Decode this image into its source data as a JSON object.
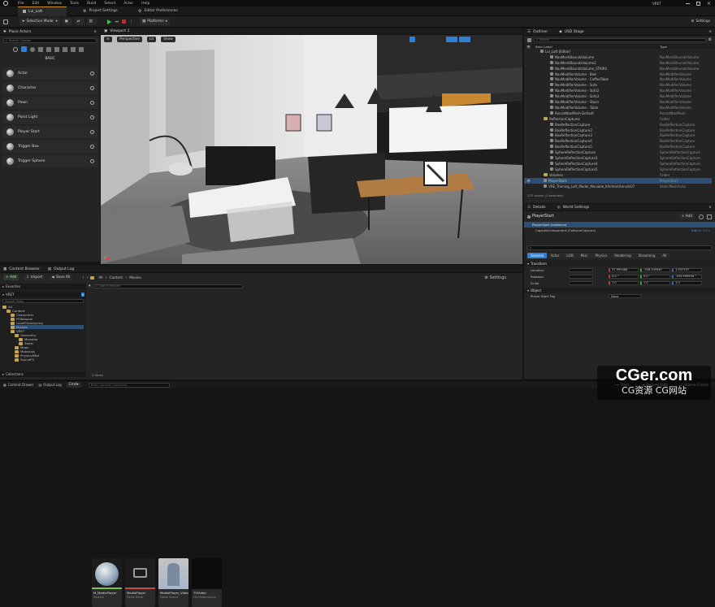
{
  "menu": [
    "File",
    "Edit",
    "Window",
    "Tools",
    "Build",
    "Select",
    "Actor",
    "Help"
  ],
  "window": {
    "level_tab": "Lvl_Loft",
    "project_settings": "Project Settings",
    "editor_prefs": "Editor Preferences",
    "user_badge": "VRET"
  },
  "toolbar": {
    "selection_mode": "Selection Mode",
    "platforms": "Platforms",
    "settings": "Settings"
  },
  "place_actors": {
    "tab": "Place Actors",
    "search_placeholder": "Search Classes",
    "category": "BASIC",
    "items": [
      "Actor",
      "Character",
      "Pawn",
      "Point Light",
      "Player Start",
      "Trigger Box",
      "Trigger Sphere"
    ]
  },
  "viewport": {
    "tab": "Viewport 1",
    "perspective": "Perspective",
    "lit": "Lit",
    "show": "Show"
  },
  "outliner": {
    "tab1": "Outliner",
    "tab2": "USD Stage",
    "search_placeholder": "Search",
    "col_label": "Item Label",
    "col_type": "Type",
    "root": "Lvl_Loft (Editor)",
    "rows": [
      {
        "n": "NavMeshBoundsVolume",
        "t": "NavMeshBoundsVolume",
        "d": 2
      },
      {
        "n": "NavMeshBoundsVolume2",
        "t": "NavMeshBoundsVolume",
        "d": 2
      },
      {
        "n": "NavMeshBoundsVolume_STAIRS",
        "t": "NavMeshBoundsVolume",
        "d": 2
      },
      {
        "n": "NavModifierVolume - Bed",
        "t": "NavModifierVolume",
        "d": 2
      },
      {
        "n": "NavModifierVolume - CoffeeTable",
        "t": "NavModifierVolume",
        "d": 2
      },
      {
        "n": "NavModifierVolume - Sofa",
        "t": "NavModifierVolume",
        "d": 2
      },
      {
        "n": "NavModifierVolume - Sofa2",
        "t": "NavModifierVolume",
        "d": 2
      },
      {
        "n": "NavModifierVolume - Sofa3",
        "t": "NavModifierVolume",
        "d": 2
      },
      {
        "n": "NavModifierVolume - Stairs",
        "t": "NavModifierVolume",
        "d": 2
      },
      {
        "n": "NavModifierVolume - Table",
        "t": "NavModifierVolume",
        "d": 2
      },
      {
        "n": "RecastNavMesh-Default",
        "t": "RecastNavMesh",
        "d": 2
      },
      {
        "n": "ReflectionCaptures",
        "t": "Folder",
        "d": 1,
        "f": true
      },
      {
        "n": "BoxReflectionCapture",
        "t": "BoxReflectionCapture",
        "d": 2
      },
      {
        "n": "BoxReflectionCapture2",
        "t": "BoxReflectionCapture",
        "d": 2
      },
      {
        "n": "BoxReflectionCapture3",
        "t": "BoxReflectionCapture",
        "d": 2
      },
      {
        "n": "BoxReflectionCapture4",
        "t": "BoxReflectionCapture",
        "d": 2
      },
      {
        "n": "BoxReflectionCapture5",
        "t": "BoxReflectionCapture",
        "d": 2
      },
      {
        "n": "SphereReflectionCapture",
        "t": "SphereReflectionCapture",
        "d": 2
      },
      {
        "n": "SphereReflectionCapture3",
        "t": "SphereReflectionCapture",
        "d": 2
      },
      {
        "n": "SphereReflectionCapture4",
        "t": "SphereReflectionCapture",
        "d": 2
      },
      {
        "n": "SphereReflectionCapture5",
        "t": "SphereReflectionCapture",
        "d": 2
      },
      {
        "n": "Volumes",
        "t": "Folder",
        "d": 1,
        "f": true
      },
      {
        "n": "PlayerStart",
        "t": "PlayerStart",
        "d": 1,
        "sel": true
      },
      {
        "n": "VRE_Training_Loft_Model_Movable_KitchenUtensils07",
        "t": "StaticMeshActor",
        "d": 1
      }
    ],
    "footer": "237 actors (1 selected)"
  },
  "details": {
    "tab1": "Details",
    "tab2": "World Settings",
    "actor": "PlayerStart",
    "add": "+ Add",
    "instance": "PlayerStart (Instance)",
    "component": "CapsuleComponent (CollisionCapsule)",
    "edit_cpp": "Edit in C++",
    "filters": [
      "General",
      "Actor",
      "LOD",
      "Misc",
      "Physics",
      "Rendering",
      "Streaming",
      "All"
    ],
    "transform_label": "Transform",
    "location_label": "Location",
    "rotation_label": "Rotation",
    "scale_label": "Scale",
    "location": [
      "37.999488",
      "-308.349467",
      "1.937297"
    ],
    "rotation": [
      "0.0 °",
      "0.0 °",
      "-359.999996 °"
    ],
    "scale": [
      "1.0",
      "1.0",
      "1.0"
    ],
    "object_label": "Object",
    "player_start_tag_label": "Player Start Tag",
    "player_start_tag": "None"
  },
  "content": {
    "tab1": "Content Browser",
    "tab2": "Output Log",
    "add": "+ Add",
    "import": "Import",
    "save_all": "Save All",
    "bc_all": "All",
    "bc_content": "Content",
    "bc_movies": "Movies",
    "settings": "Settings",
    "favorites": "Favorites",
    "project": "VRET",
    "search_paths": "Search Paths",
    "search_movies": "Search Movies",
    "collections": "Collections",
    "items_count": "4 items",
    "tree": [
      {
        "n": "All",
        "d": 0
      },
      {
        "n": "Content",
        "d": 1
      },
      {
        "n": "Characters",
        "d": 2
      },
      {
        "n": "FPWeapon",
        "d": 2
      },
      {
        "n": "LevelPrototyping",
        "d": 2
      },
      {
        "n": "Movies",
        "d": 2,
        "sel": true
      },
      {
        "n": "VRET",
        "d": 2
      },
      {
        "n": "Geometry",
        "d": 3
      },
      {
        "n": "Movable",
        "d": 4
      },
      {
        "n": "Static",
        "d": 4
      },
      {
        "n": "Maps",
        "d": 3
      },
      {
        "n": "Materials",
        "d": 3
      },
      {
        "n": "PhysicalMat",
        "d": 3
      },
      {
        "n": "SoundFX",
        "d": 3
      }
    ],
    "assets": [
      {
        "n": "M_MediaPlayer",
        "t": "Material"
      },
      {
        "n": "MediaPlayer",
        "t": "Media Player"
      },
      {
        "n": "MediaPlayer_Video",
        "t": "Media Texture"
      },
      {
        "n": "TVVideo",
        "t": "File Media Source"
      }
    ]
  },
  "status": {
    "content_drawer": "Content Drawer",
    "output_log": "Output Log",
    "cmd": "Cmd",
    "console_placeholder": "Enter Console Command",
    "trace": "Trace",
    "derived_data": "Derived Data",
    "source_control": "Source Control"
  },
  "watermark": {
    "logo": "CGer.com",
    "sub": "CG资源 CG网站"
  },
  "colors": {
    "accent": "#2f7fd6",
    "folder": "#c9a34a",
    "selection": "#2c4f73"
  }
}
